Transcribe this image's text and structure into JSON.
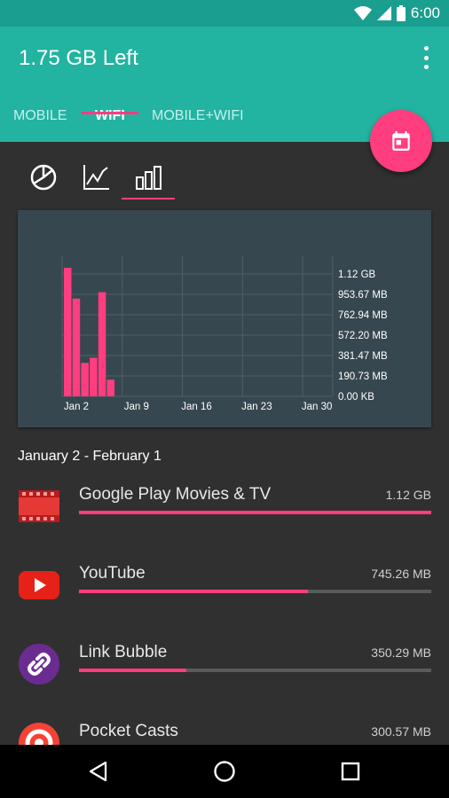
{
  "status_bar": {
    "time": "6:00",
    "icons": [
      "wifi-icon",
      "cell-signal-icon",
      "battery-icon"
    ]
  },
  "app_bar": {
    "title": "1.75 GB Left",
    "tabs": [
      {
        "label": "MOBILE",
        "active": false
      },
      {
        "label": "WIFI",
        "active": true
      },
      {
        "label": "MOBILE+WIFI",
        "active": false
      }
    ],
    "fab_icon": "calendar-icon",
    "menu_icon": "more-vert-icon"
  },
  "chart_tabs": [
    "pie-chart-icon",
    "line-chart-icon",
    "bar-chart-icon"
  ],
  "chart_data": {
    "type": "bar",
    "categories": [
      "Jan 2",
      "Jan 3",
      "Jan 4",
      "Jan 5",
      "Jan 6",
      "Jan 7",
      "Jan 8"
    ],
    "values": [
      1.0,
      0.76,
      0.26,
      0.3,
      0.81,
      0.13,
      0
    ],
    "x_ticks": [
      "Jan 2",
      "Jan 9",
      "Jan 16",
      "Jan 23",
      "Jan 30"
    ],
    "y_ticks": [
      "1.12 GB",
      "953.67 MB",
      "762.94 MB",
      "572.20 MB",
      "381.47 MB",
      "190.73 MB",
      "0.00 KB"
    ],
    "ylabel_unit": "GB",
    "ylim": [
      0,
      1.12
    ],
    "grid": true,
    "bar_color": "#ff3d7f"
  },
  "period": "January 2 - February 1",
  "apps": [
    {
      "name": "Google Play Movies & TV",
      "size": "1.12 GB",
      "fraction": 1.0,
      "icon": "movies-icon"
    },
    {
      "name": "YouTube",
      "size": "745.26 MB",
      "fraction": 0.65,
      "icon": "youtube-icon"
    },
    {
      "name": "Link Bubble",
      "size": "350.29 MB",
      "fraction": 0.305,
      "icon": "link-bubble-icon"
    },
    {
      "name": "Pocket Casts",
      "size": "300.57 MB",
      "fraction": 0.26,
      "icon": "pocket-casts-icon"
    }
  ],
  "colors": {
    "teal": "#22b3a1",
    "teal_dark": "#1a9e8f",
    "accent": "#ff3d7f",
    "background": "#303030",
    "card": "#37474f"
  }
}
